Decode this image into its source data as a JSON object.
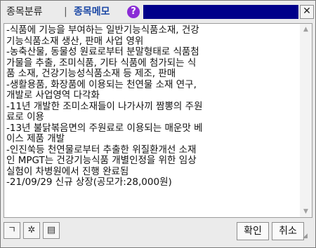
{
  "header": {
    "tab_category": "종목분류",
    "separator": "|",
    "tab_memo": "종목메모",
    "help_glyph": "?",
    "close_glyph": "✕"
  },
  "memo": {
    "text": "-식품에 기능을 부여하는 일반기능식품소재, 건강\n기능식품소재 생산, 판매 사업 영위\n-농축산물, 동물성 원료로부터 분말형태로 식품첨\n가물을 추출, 조미식품, 기타 식품에 첨가되는 식\n품 소재, 건강기능성식품소재 등 제조, 판매\n-생활용품, 화장품에 이용되는 천연물 소재 연구,\n개발로 사업영역 다각화\n-11년 개발한 조미소재들이 나가사끼 짬뽕의 주원\n료로 이용\n-13년 불닭볶음면의 주원료로 이용되는 매운맛 베\n이스 제품 개발\n-인진쑥등 천연물로부터 추출한 위질환개선 소재\n인 MPGT는 건강기능식품 개별인정을 위한 임상\n실험이 차병원에서 진행 완료됨\n-21/09/29 신규 상장(공모가:28,000원)"
  },
  "footer": {
    "tool1_glyph": "ㄱ",
    "tool2_glyph": "✲",
    "tool3_glyph": "▤",
    "confirm_label": "확인",
    "cancel_label": "취소"
  },
  "colors": {
    "title_bar": "#00008a",
    "memo_tab": "#1d49a6",
    "help_icon": "#8a2bd6"
  }
}
